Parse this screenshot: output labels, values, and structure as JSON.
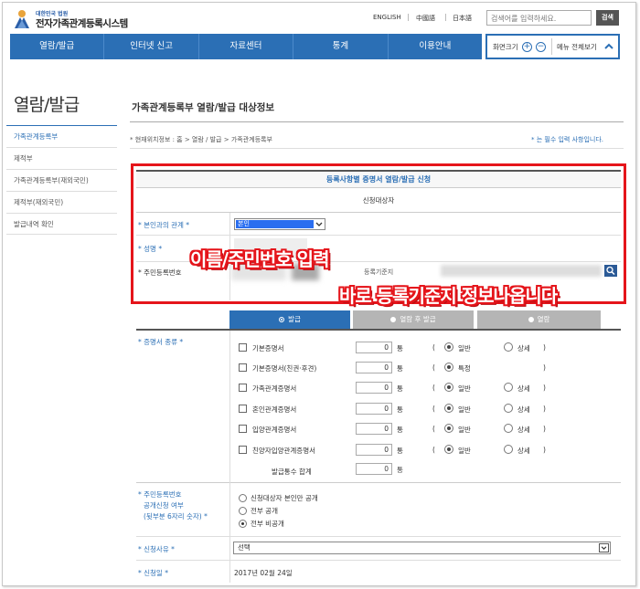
{
  "header": {
    "logo_sub": "대한민국 법원",
    "logo_main": "전자가족관계등록시스템",
    "languages": [
      "ENGLISH",
      "中國語",
      "日本語"
    ],
    "search_placeholder": "검색어를 입력하세요.",
    "search_button": "검색"
  },
  "nav": {
    "items": [
      "열람/발급",
      "인터넷 신고",
      "자료센터",
      "통계",
      "이용안내"
    ],
    "zoom_label": "화면크기",
    "menu_all_label": "메뉴 전체보기"
  },
  "sidebar": {
    "title": "열람/발급",
    "items": [
      "가족관계등록부",
      "제적부",
      "가족관계등록부(재외국민)",
      "제적부(재외국민)",
      "발급내역 확인"
    ],
    "active_index": 0
  },
  "content": {
    "title": "가족관계등록부 열람/발급 대상정보",
    "breadcrumb": "* 현재위치정보 : 홈 > 열람 / 발급 > 가족관계등록부",
    "required_note": "* 는 필수 입력 사항입니다."
  },
  "applicant": {
    "header": "등록사항별 증명서 열람/발급 신청",
    "subheader": "신청대상자",
    "relation_label": "* 본인과의 관계 *",
    "relation_value": "본인",
    "name_label": "* 성명 *",
    "rrn_label": "* 주민등록번호",
    "reg_base_label": "등록기준지"
  },
  "overlay": {
    "line1": "이름/주민번호 입력",
    "line2": "바로 등록기준지 정보나옵니다"
  },
  "tabs": [
    "발급",
    "열람 후 발급",
    "열람"
  ],
  "certificate": {
    "label": "* 증명서 종류 *",
    "rows": [
      {
        "name": "기본증명서",
        "qty": "0",
        "unit": "통",
        "opt1": "일반",
        "opt2": "상세",
        "opt1_on": true,
        "has_opt2": true
      },
      {
        "name": "기본증명서(친권·후견)",
        "qty": "0",
        "unit": "통",
        "opt1": "특정",
        "opt2": "",
        "opt1_on": true,
        "has_opt2": false
      },
      {
        "name": "가족관계증명서",
        "qty": "0",
        "unit": "통",
        "opt1": "일반",
        "opt2": "상세",
        "opt1_on": true,
        "has_opt2": true
      },
      {
        "name": "혼인관계증명서",
        "qty": "0",
        "unit": "통",
        "opt1": "일반",
        "opt2": "상세",
        "opt1_on": true,
        "has_opt2": true
      },
      {
        "name": "입양관계증명서",
        "qty": "0",
        "unit": "통",
        "opt1": "일반",
        "opt2": "상세",
        "opt1_on": true,
        "has_opt2": true
      },
      {
        "name": "친양자입양관계증명서",
        "qty": "0",
        "unit": "통",
        "opt1": "일반",
        "opt2": "상세",
        "opt1_on": true,
        "has_opt2": true
      }
    ],
    "total_label": "발급통수 합계",
    "total_qty": "0",
    "total_unit": "통"
  },
  "disclosure": {
    "label_lines": [
      "* 주민등록번호",
      "공개신청 여부",
      "(뒷부분 6자리 숫자) *"
    ],
    "options": [
      "신청대상자 본인만 공개",
      "전부 공개",
      "전부 비공개"
    ],
    "selected_index": 2
  },
  "reason": {
    "label": "* 신청사유 *",
    "value": "선택"
  },
  "date": {
    "label": "* 신청일 *",
    "value": "2017년 02월 24일"
  }
}
